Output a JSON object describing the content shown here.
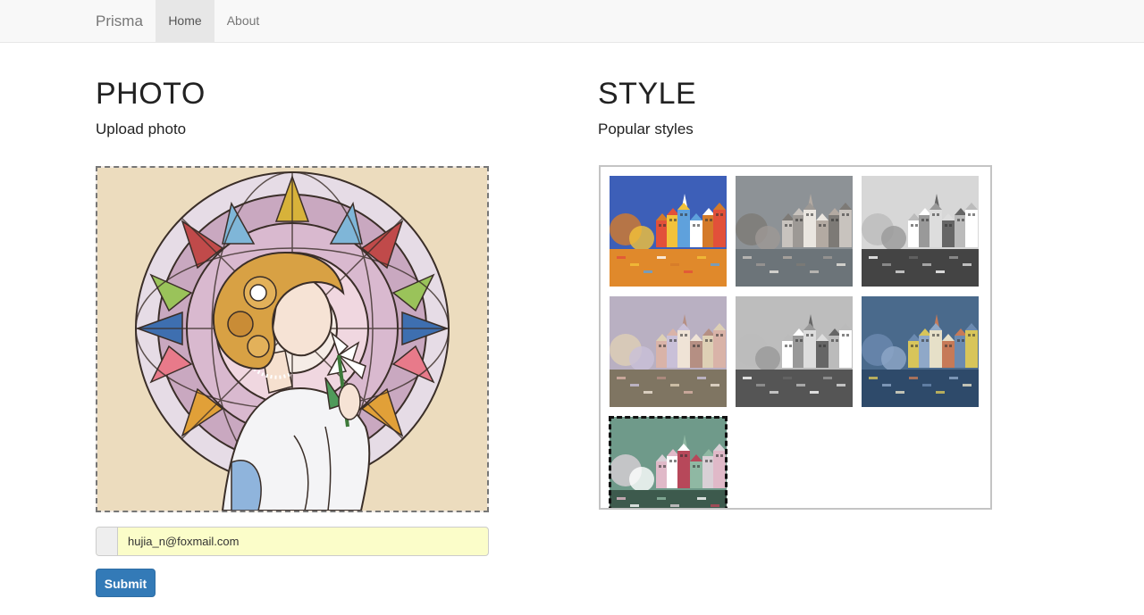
{
  "navbar": {
    "brand": "Prisma",
    "items": [
      {
        "label": "Home",
        "active": true
      },
      {
        "label": "About",
        "active": false
      }
    ]
  },
  "photo": {
    "heading": "PHOTO",
    "subheading": "Upload photo",
    "image": "stained-glass-woman-image",
    "upload_value": "hujia_n@foxmail.com",
    "submit_label": "Submit"
  },
  "style": {
    "heading": "STYLE",
    "subheading": "Popular styles",
    "thumbnails": [
      {
        "name": "style-vivid-colorful",
        "sky": "#3d5fb8",
        "water": "#e0892b",
        "tone": "color",
        "selected": false
      },
      {
        "name": "style-muted-sketch",
        "sky": "#8d9296",
        "water": "#6c7479",
        "tone": "muted",
        "selected": false
      },
      {
        "name": "style-black-white",
        "sky": "#d7d7d7",
        "water": "#444444",
        "tone": "gray",
        "selected": false
      },
      {
        "name": "style-pastel-crosshatch",
        "sky": "#b9b0c2",
        "water": "#7f7562",
        "tone": "pastel",
        "selected": false
      },
      {
        "name": "style-pencil-gray",
        "sky": "#bdbdbd",
        "water": "#555555",
        "tone": "gray",
        "selected": false
      },
      {
        "name": "style-blue-mosaic",
        "sky": "#4a6a8c",
        "water": "#2e4a6a",
        "tone": "blue",
        "selected": false
      },
      {
        "name": "style-green-impressionist",
        "sky": "#6f9a8a",
        "water": "#3d5a4d",
        "tone": "green",
        "selected": true
      }
    ]
  },
  "colors": {
    "primary": "#337ab7",
    "autofill_bg": "#fbfdc9",
    "navbar_bg": "#f8f8f8"
  }
}
